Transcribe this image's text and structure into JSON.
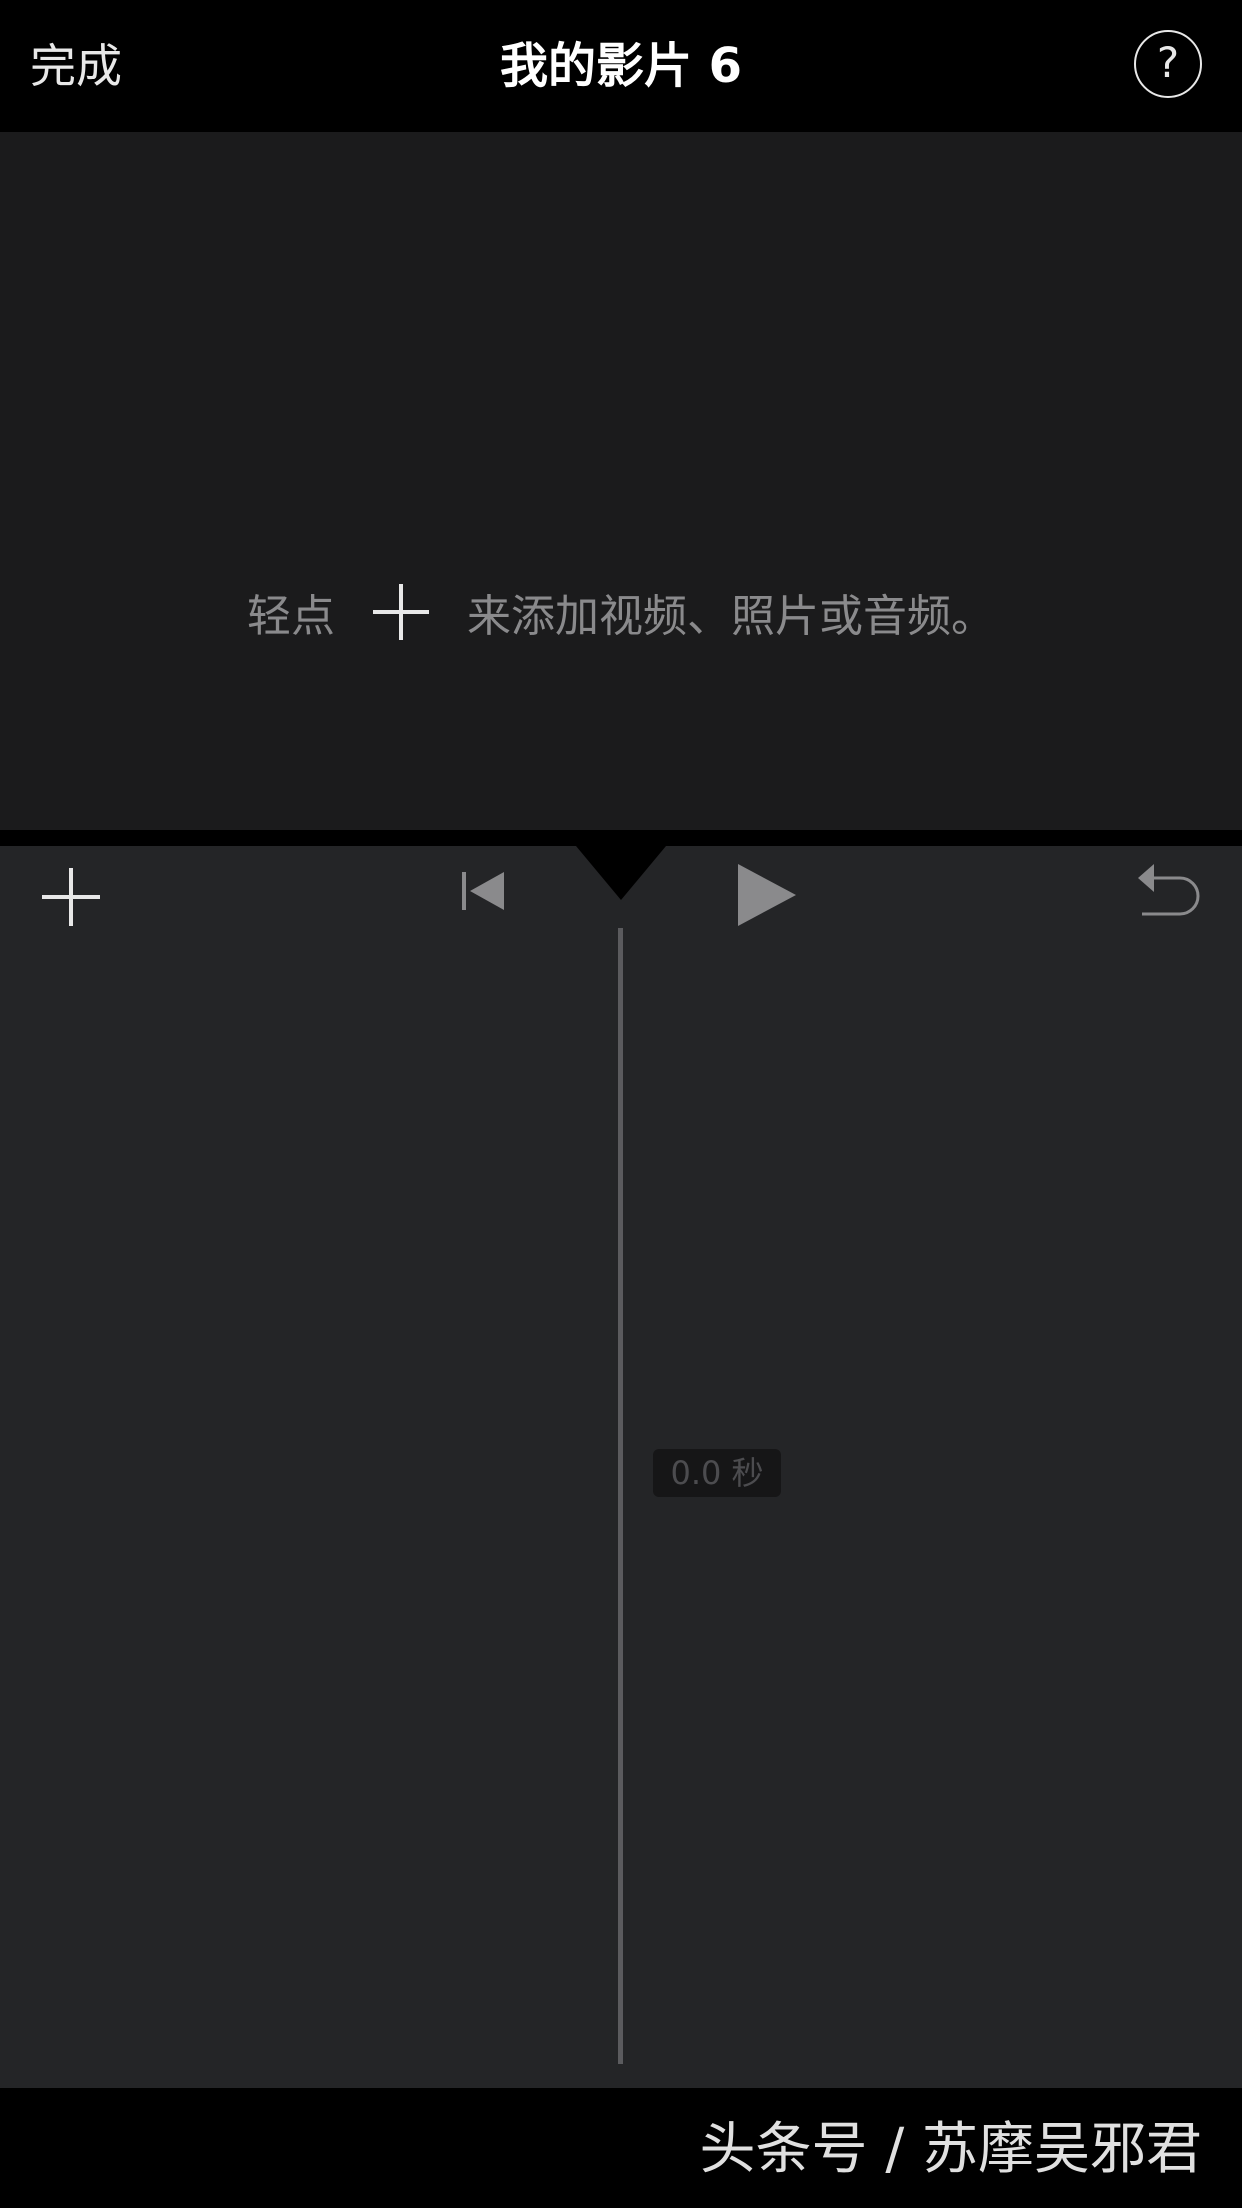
{
  "header": {
    "done_label": "完成",
    "title": "我的影片 6",
    "help_label": "?"
  },
  "viewer": {
    "hint_prefix": "轻点",
    "hint_suffix": "来添加视频、照片或音频。",
    "hint_icon": "plus-icon"
  },
  "toolbar": {
    "add_icon": "plus-icon",
    "skip_back_icon": "skip-to-start-icon",
    "play_icon": "play-icon",
    "undo_icon": "undo-icon"
  },
  "timeline": {
    "duration_label": "0.0 秒"
  },
  "watermark": {
    "text": "头条号 / 苏摩吴邪君"
  },
  "colors": {
    "background": "#000000",
    "viewer_bg": "#1b1b1c",
    "timeline_bg": "#242527",
    "icon_gray": "#8a8a8c",
    "text_white": "#ffffff"
  }
}
